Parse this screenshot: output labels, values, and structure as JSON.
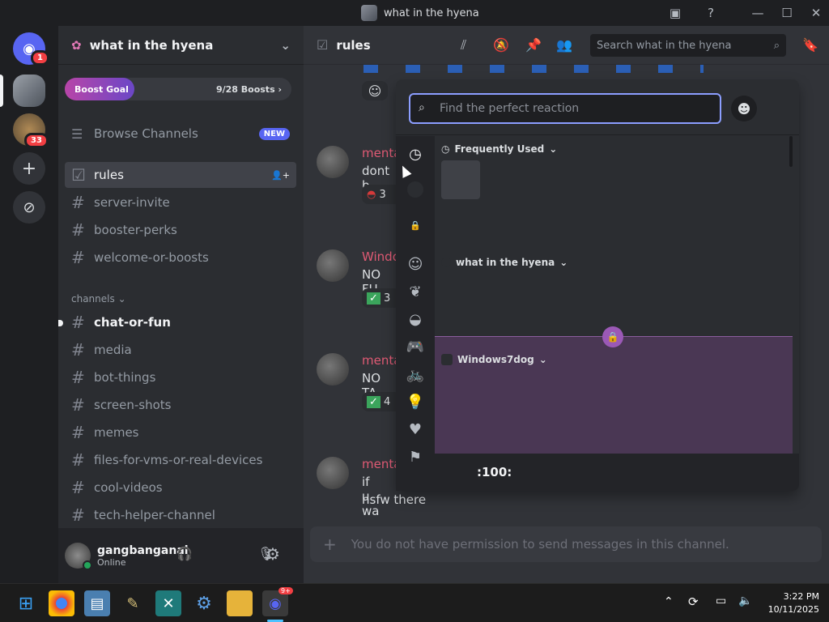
{
  "window": {
    "title": "what in the hyena"
  },
  "rail": {
    "home_badge": "1",
    "server2_badge": "33"
  },
  "server": {
    "name": "what in the hyena",
    "boost_goal_label": "Boost Goal",
    "boost_count": "9/28 Boosts",
    "browse_channels": "Browse Channels",
    "new_badge": "NEW",
    "category": "channels",
    "channels_top": [
      {
        "name": "rules",
        "active": true
      },
      {
        "name": "server-invite"
      },
      {
        "name": "booster-perks"
      },
      {
        "name": "welcome-or-boosts"
      }
    ],
    "channels": [
      {
        "name": "chat-or-fun",
        "unread": true
      },
      {
        "name": "media"
      },
      {
        "name": "bot-things"
      },
      {
        "name": "screen-shots"
      },
      {
        "name": "memes"
      },
      {
        "name": "files-for-vms-or-real-devices"
      },
      {
        "name": "cool-videos"
      },
      {
        "name": "tech-helper-channel"
      }
    ]
  },
  "user": {
    "name": "gangbanganal",
    "status": "Online"
  },
  "chat": {
    "channel": "rules",
    "search_placeholder": "Search what in the hyena",
    "messages": [
      {
        "author": "menta",
        "text": "dont b",
        "reaction_count": "3"
      },
      {
        "author": "Windo",
        "text": "NO FU",
        "reaction_count": "3"
      },
      {
        "author": "menta",
        "text": "NO TA",
        "reaction_count": "4"
      },
      {
        "author": "menta",
        "text": "if u wa",
        "text2": "nsfw there"
      }
    ],
    "composer_placeholder": "You do not have permission to send messages in this channel."
  },
  "picker": {
    "search_placeholder": "Find the perfect reaction",
    "sections": [
      "Frequently Used",
      "what in the hyena",
      "Windows7dog"
    ],
    "hover_emoji": ":100:"
  },
  "taskbar": {
    "time": "3:22 PM",
    "date": "10/11/2025",
    "discord_badge": "9+"
  },
  "colors": {
    "accent": "#5865f2",
    "locked_band": "#4a3754",
    "lock_badge": "#9b59b6"
  }
}
